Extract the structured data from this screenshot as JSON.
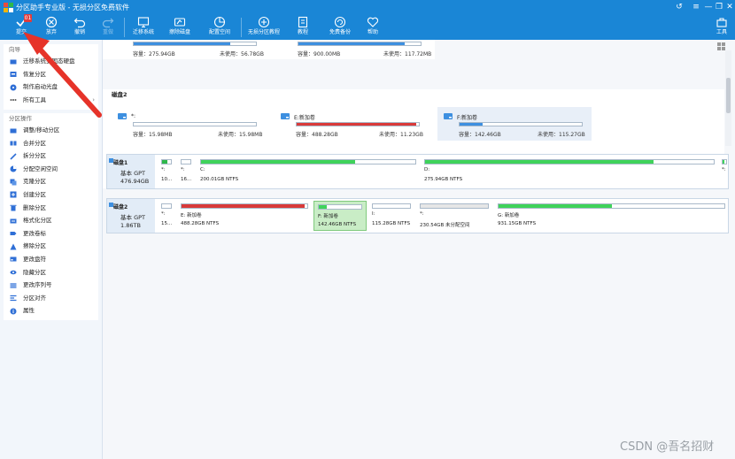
{
  "window": {
    "title": "分区助手专业版 - 无损分区免费软件",
    "controls": [
      "↺",
      "≡",
      "—",
      "❐",
      "✕"
    ]
  },
  "toolbar": {
    "commit": {
      "label": "提交",
      "badge": "01"
    },
    "discard": {
      "label": "放弃"
    },
    "undo": {
      "label": "撤销"
    },
    "redo": {
      "label": "重做"
    },
    "migrate": {
      "label": "迁移系统"
    },
    "wipe": {
      "label": "擦除磁盘"
    },
    "alloc": {
      "label": "配置空间"
    },
    "lossless": {
      "label": "无损分区教程"
    },
    "tutorial": {
      "label": "教程"
    },
    "backup": {
      "label": "免费备份"
    },
    "help": {
      "label": "帮助"
    },
    "tools": {
      "label": "工具"
    }
  },
  "sidebar": {
    "wizard": {
      "title": "向导",
      "items": [
        {
          "label": "迁移系统到固态硬盘"
        },
        {
          "label": "恢复分区"
        },
        {
          "label": "制作启动光盘"
        },
        {
          "label": "所有工具",
          "arrow": "›"
        }
      ]
    },
    "ops": {
      "title": "分区操作",
      "items": [
        {
          "label": "调整/移动分区"
        },
        {
          "label": "合并分区"
        },
        {
          "label": "拆分分区"
        },
        {
          "label": "分配空闲空间"
        },
        {
          "label": "克隆分区"
        },
        {
          "label": "创建分区"
        },
        {
          "label": "删除分区"
        },
        {
          "label": "格式化分区"
        },
        {
          "label": "更改卷标"
        },
        {
          "label": "擦除分区"
        },
        {
          "label": "更改盘符"
        },
        {
          "label": "隐藏分区"
        },
        {
          "label": "更改序列号"
        },
        {
          "label": "分区对齐"
        },
        {
          "label": "属性"
        }
      ]
    }
  },
  "top_cards": [
    {
      "capacity": "容量：275.94GB",
      "free": "未使用：56.78GB",
      "fill": 0.79
    },
    {
      "capacity": "容量：900.00MB",
      "free": "未使用：117.72MB",
      "fill": 0.87
    }
  ],
  "disk2_view": {
    "label": "磁盘2",
    "partitions": [
      {
        "name": "*:",
        "capacity": "容量：15.98MB",
        "free": "未使用：15.98MB",
        "fill": 0.0,
        "color": "#2fb84a"
      },
      {
        "name": "E:新加卷",
        "capacity": "容量：488.28GB",
        "free": "未使用：11.23GB",
        "fill": 0.98,
        "color": "#d93a3a"
      },
      {
        "name": "F:新加卷",
        "capacity": "容量：142.46GB",
        "free": "未使用：115.27GB",
        "fill": 0.19,
        "color": "#3d8fe0"
      }
    ]
  },
  "disk_map": [
    {
      "name": "磁盘1",
      "type": "基本 GPT",
      "size": "476.94GB",
      "parts": [
        {
          "l1": "*:",
          "l2": "10...",
          "fill": 0.6,
          "color": "#2fb84a"
        },
        {
          "l1": "*:",
          "l2": "16...",
          "fill": 0.0,
          "color": "#2fb84a"
        },
        {
          "l1": "C:",
          "l2": "200.01GB NTFS",
          "fill": 0.72,
          "color": "#3fd35a"
        },
        {
          "l1": "D:",
          "l2": "275.94GB NTFS",
          "fill": 0.79,
          "color": "#3fd35a"
        },
        {
          "l1": "*:",
          "l2": "",
          "fill": 0.5,
          "color": "#3fd35a"
        }
      ]
    },
    {
      "name": "磁盘2",
      "type": "基本 GPT",
      "size": "1.86TB",
      "parts": [
        {
          "l1": "*:",
          "l2": "15...",
          "fill": 0.0,
          "color": "#2fb84a"
        },
        {
          "l1": "E: 新加卷",
          "l2": "488.28GB NTFS",
          "fill": 0.98,
          "color": "#d93a3a"
        },
        {
          "l1": "F: 新加卷",
          "l2": "142.46GB NTFS",
          "fill": 0.19,
          "color": "#3fd35a"
        },
        {
          "l1": "I:",
          "l2": "115.28GB NTFS",
          "fill": 0.0,
          "color": "#3fd35a"
        },
        {
          "l1": "*:",
          "l2": "230.54GB 未分配空间",
          "fill": 1.0,
          "color": "#e6e6e6"
        },
        {
          "l1": "G: 新加卷",
          "l2": "931.15GB NTFS",
          "fill": 0.5,
          "color": "#3fd35a"
        }
      ]
    }
  ],
  "watermark": "CSDN @吾名招财"
}
